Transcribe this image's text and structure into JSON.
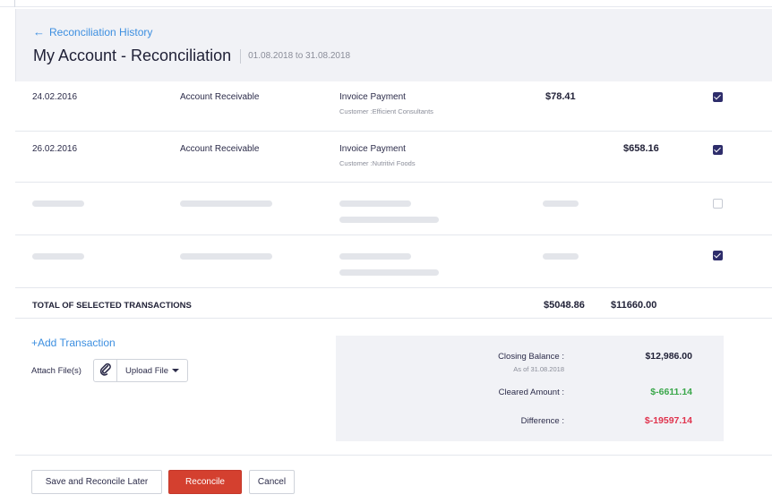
{
  "nav": {
    "back_label": "Reconciliation History",
    "back_arrow": "←"
  },
  "header": {
    "title": "My Account - Reconciliation",
    "date_range": "01.08.2018 to 31.08.2018"
  },
  "transactions": [
    {
      "date": "24.02.2016",
      "account": "Account Receivable",
      "description": "Invoice Payment",
      "customer": "Customer :Efficient Consultants",
      "payment": "$78.41",
      "deposit": "",
      "selected": true
    },
    {
      "date": "26.02.2016",
      "account": "Account Receivable",
      "description": "Invoice Payment",
      "customer": "Customer :Nutritivi Foods",
      "payment": "",
      "deposit": "$658.16",
      "selected": true
    }
  ],
  "placeholder_rows": [
    {
      "selected": false
    },
    {
      "selected": true
    }
  ],
  "totals": {
    "label": "TOTAL OF SELECTED TRANSACTIONS",
    "payments": "$5048.86",
    "deposits": "$11660.00"
  },
  "actions": {
    "add_transaction": "+Add Transaction",
    "attach_label": "Attach File(s)",
    "upload_label": "Upload File"
  },
  "summary": {
    "closing_balance_label": "Closing Balance :",
    "closing_balance_sub": "As of 31.08.2018",
    "closing_balance_value": "$12,986.00",
    "cleared_label": "Cleared Amount :",
    "cleared_value": "$-6611.14",
    "difference_label": "Difference :",
    "difference_value": "$-19597.14"
  },
  "buttons": {
    "save_later": "Save and Reconcile Later",
    "reconcile": "Reconcile",
    "cancel": "Cancel"
  },
  "colors": {
    "link": "#3d8fe0",
    "checkbox": "#2e2d6b",
    "positive": "#3aa74a",
    "negative": "#e0334d",
    "primary_button": "#d4402f"
  },
  "icons": {
    "back": "arrow-left-icon",
    "attach": "paperclip-icon",
    "dropdown": "caret-down-icon",
    "checkbox": "checkbox-icon"
  }
}
